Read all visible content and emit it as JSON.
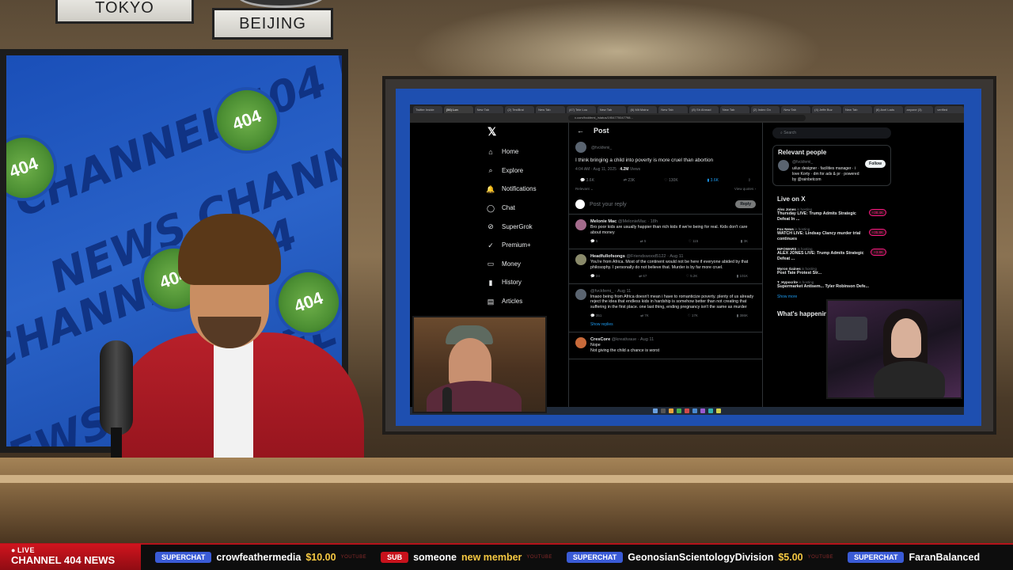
{
  "studio": {
    "city_signs": [
      "TOKYO",
      "BEIJING"
    ],
    "bg_words": [
      "CHANNEL 404 NEWS",
      "NEWS CHANNEL",
      "CHANNEL 404",
      "NEWS CHANNEL 404",
      "WS CH"
    ],
    "logo_text": "404"
  },
  "browser": {
    "tabs": [
      "Twitter Inside",
      "(56) Lon",
      "New Tab",
      "(2) TestBrai",
      "New Tab",
      "(47) Tele Lou",
      "New Tab",
      "(6) Mit Mainz",
      "New Tab",
      "(8) Sh Ahmad",
      "New Tab",
      "(2) Index Gn",
      "New Tab",
      "(4) Jeffe Buz",
      "New Tab",
      "(6) Axel Lads",
      "anyone (3)",
      "verified"
    ],
    "url": "x.com/fvckfemi_/status/1954770047798..."
  },
  "x_nav": {
    "logo": "𝕏",
    "items": [
      {
        "icon": "home-icon",
        "glyph": "⌂",
        "label": "Home"
      },
      {
        "icon": "search-icon",
        "glyph": "⌕",
        "label": "Explore"
      },
      {
        "icon": "bell-icon",
        "glyph": "🔔",
        "label": "Notifications"
      },
      {
        "icon": "chat-icon",
        "glyph": "◯",
        "label": "Chat"
      },
      {
        "icon": "grok-icon",
        "glyph": "⊘",
        "label": "SuperGrok"
      },
      {
        "icon": "premium-icon",
        "glyph": "✓",
        "label": "Premium+"
      },
      {
        "icon": "money-icon",
        "glyph": "▭",
        "label": "Money"
      },
      {
        "icon": "history-icon",
        "glyph": "▮",
        "label": "History"
      },
      {
        "icon": "articles-icon",
        "glyph": "▤",
        "label": "Articles"
      }
    ]
  },
  "post": {
    "back": "←",
    "header": "Post",
    "handle": "@fvckfemi_",
    "text": "I think bringing a child into poverty is more cruel than abortion",
    "time": "4:04 AM · Aug 11, 2025 ·",
    "views_count": "4.2M",
    "views_label": "Views",
    "actions": [
      "3.6K",
      "23K",
      "130K",
      "3.6K"
    ],
    "relevant": "Relevant ⌄",
    "view_quotes": "View quotes ›",
    "reply_placeholder": "Post your reply",
    "reply_button": "Reply"
  },
  "replies": [
    {
      "name": "Melonie Mac",
      "handle": "@MelonieMac · 18h",
      "text": "Bro poor kids are usually happier than rich kids if we're being for real. Kids don't care about money",
      "acts": [
        "5",
        "5",
        "115",
        "3K"
      ],
      "avatar": "#a46b8c"
    },
    {
      "name": "Headfullofsongs",
      "handle": "@Friendswood5122 · Aug 11",
      "text": "You're from Africa.  Most of the continent would not be here if everyone abided by that philosophy.  I personally do not believe that.  Murder is by far more cruel.",
      "acts": [
        "24",
        "67",
        "5.2K",
        "101K"
      ],
      "avatar": "#8a8a6a"
    },
    {
      "name": "",
      "handle": "@fvckfemi_ · Aug 11",
      "text": "lmaoo being from Africa doesn't mean i have to romanticize poverty. plenty of us already reject the idea that endless kids in hardship is somehow better than not creating that suffering in the first place. one last thing, ending pregnancy isn't the same as murder",
      "acts": [
        "351",
        "7K",
        "17K",
        "386K"
      ],
      "avatar": "#5a6470"
    },
    {
      "name": "CresCore",
      "handle": "@kreativaue · Aug 11",
      "text": "Nope\nNot giving the child a chance is worst",
      "acts": [],
      "avatar": "#c86a3a"
    }
  ],
  "show_replies": "Show replies",
  "right": {
    "search": "Search",
    "relevant_title": "Relevant people",
    "person_handle": "@fvckfemi_",
    "person_bio": "ui/ux designer · facilities manager · i love Korty · dm for ads & pr · powered by @rainbetcom",
    "follow": "Follow",
    "live_title": "Live on X",
    "live": [
      {
        "host": "Alex Jones",
        "status": "is hosting",
        "title": "Thursday LIVE: Trump Admits Strategic Defeat In ...",
        "count": "+38.4K"
      },
      {
        "host": "Fox News",
        "status": "is hosting",
        "title": "WATCH LIVE: Lindsay Clancy murder trial continues",
        "count": "+35.8K"
      },
      {
        "host": "INFOWARS",
        "status": "is hosting",
        "title": "ALEX JONES LIVE: Trump Admits Strategic Defeat ...",
        "count": "+3.8K"
      },
      {
        "host": "Myron Gaines",
        "status": "is hosting",
        "title": "Post Tate Protest Str...",
        "count": ""
      },
      {
        "host": "T_Hypocrite",
        "status": "is hosting",
        "title": "Supermarket Antisem... Tyler Robinson Defe...",
        "count": ""
      }
    ],
    "show_more": "Show more",
    "happening": "What's happening"
  },
  "ticker": {
    "live": "LIVE",
    "brand": "CHANNEL 404 NEWS",
    "items": [
      {
        "badge": "SUPERCHAT",
        "color": "#3a5bd6",
        "name": "crowfeathermedia",
        "amount": "$10.00",
        "src": "YOUTUBE"
      },
      {
        "badge": "SUB",
        "color": "#c8121c",
        "name": "someone",
        "amount": "new member",
        "src": "YOUTUBE"
      },
      {
        "badge": "SUPERCHAT",
        "color": "#3a5bd6",
        "name": "GeonosianScientologyDivision",
        "amount": "$5.00",
        "src": "YOUTUBE"
      },
      {
        "badge": "SUPERCHAT",
        "color": "#3a5bd6",
        "name": "FaranBalanced",
        "amount": "",
        "src": ""
      }
    ]
  }
}
